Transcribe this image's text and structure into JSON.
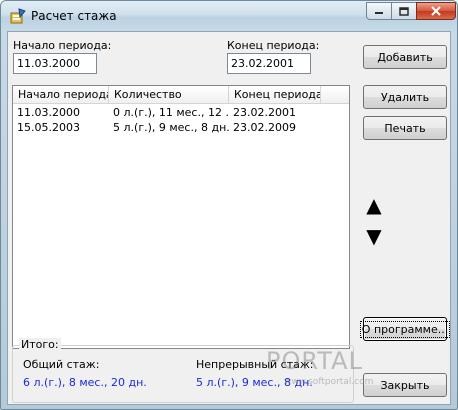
{
  "window": {
    "title": "Расчет стажа"
  },
  "form": {
    "start_label": "Начало периода:",
    "start_value": "11.03.2000",
    "end_label": "Конец периода:",
    "end_value": "23.02.2001"
  },
  "buttons": {
    "add": "Добавить",
    "delete": "Удалить",
    "print": "Печать",
    "up_glyph": "▲",
    "down_glyph": "▼",
    "about": "О программе...",
    "close": "Закрыть"
  },
  "table": {
    "columns": [
      "Начало периода",
      "Количество",
      "Конец периода"
    ],
    "rows": [
      [
        "11.03.2000",
        "0 л.(г.), 11 мес., 12 ...",
        "23.02.2001"
      ],
      [
        "15.05.2003",
        "5 л.(г.), 9 мес., 8 дн.",
        "23.02.2009"
      ]
    ]
  },
  "summary": {
    "group_title": "Итого:",
    "total_label": "Общий стаж:",
    "total_value": "6 л.(г.), 8 мес., 20 дн.",
    "continuous_label": "Непрерывный стаж:",
    "continuous_value": "5 л.(г.), 9 мес., 8 дн."
  },
  "watermark": {
    "brand": "PORTAL",
    "url": "www.softportal.com"
  },
  "colors": {
    "summary_value": "#1a2bd6",
    "titlebar": "#cfe0ec",
    "close_button": "#c33a1f"
  }
}
